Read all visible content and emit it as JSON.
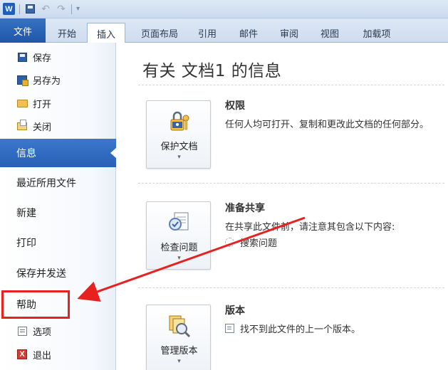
{
  "app": {
    "logo_letter": "W",
    "qat": {
      "undo_glyph": "↶",
      "redo_glyph": "↷",
      "dropdown_glyph": "▾"
    }
  },
  "ribbon": {
    "tabs": [
      {
        "label": "文件"
      },
      {
        "label": "开始"
      },
      {
        "label": "插入"
      },
      {
        "label": "页面布局"
      },
      {
        "label": "引用"
      },
      {
        "label": "邮件"
      },
      {
        "label": "审阅"
      },
      {
        "label": "视图"
      },
      {
        "label": "加载项"
      }
    ]
  },
  "nav": {
    "items": [
      {
        "label": "保存",
        "icon": "save-icon"
      },
      {
        "label": "另存为",
        "icon": "save-as-icon"
      },
      {
        "label": "打开",
        "icon": "open-folder-icon"
      },
      {
        "label": "关闭",
        "icon": "close-file-icon"
      },
      {
        "label": "信息",
        "active": true
      },
      {
        "label": "最近所用文件"
      },
      {
        "label": "新建"
      },
      {
        "label": "打印"
      },
      {
        "label": "保存并发送"
      },
      {
        "label": "帮助"
      },
      {
        "label": "选项",
        "icon": "options-icon"
      },
      {
        "label": "退出",
        "icon": "exit-icon"
      }
    ],
    "exit_glyph": "X"
  },
  "main": {
    "title": "有关 文档1 的信息",
    "sections": [
      {
        "button_label": "保护文档",
        "heading": "权限",
        "description": "任何人均可打开、复制和更改此文档的任何部分。"
      },
      {
        "button_label": "检查问题",
        "heading": "准备共享",
        "description": "在共享此文件前，请注意其包含以下内容:",
        "item": "搜索问题"
      },
      {
        "button_label": "管理版本",
        "heading": "版本",
        "item": "找不到此文件的上一个版本。"
      }
    ],
    "dropdown_glyph": "▾"
  },
  "colors": {
    "file_tab": "#2860b4",
    "active_nav": "#2f6bc0",
    "highlight": "#e8201f",
    "annotation_arrow": "#e8201f"
  }
}
